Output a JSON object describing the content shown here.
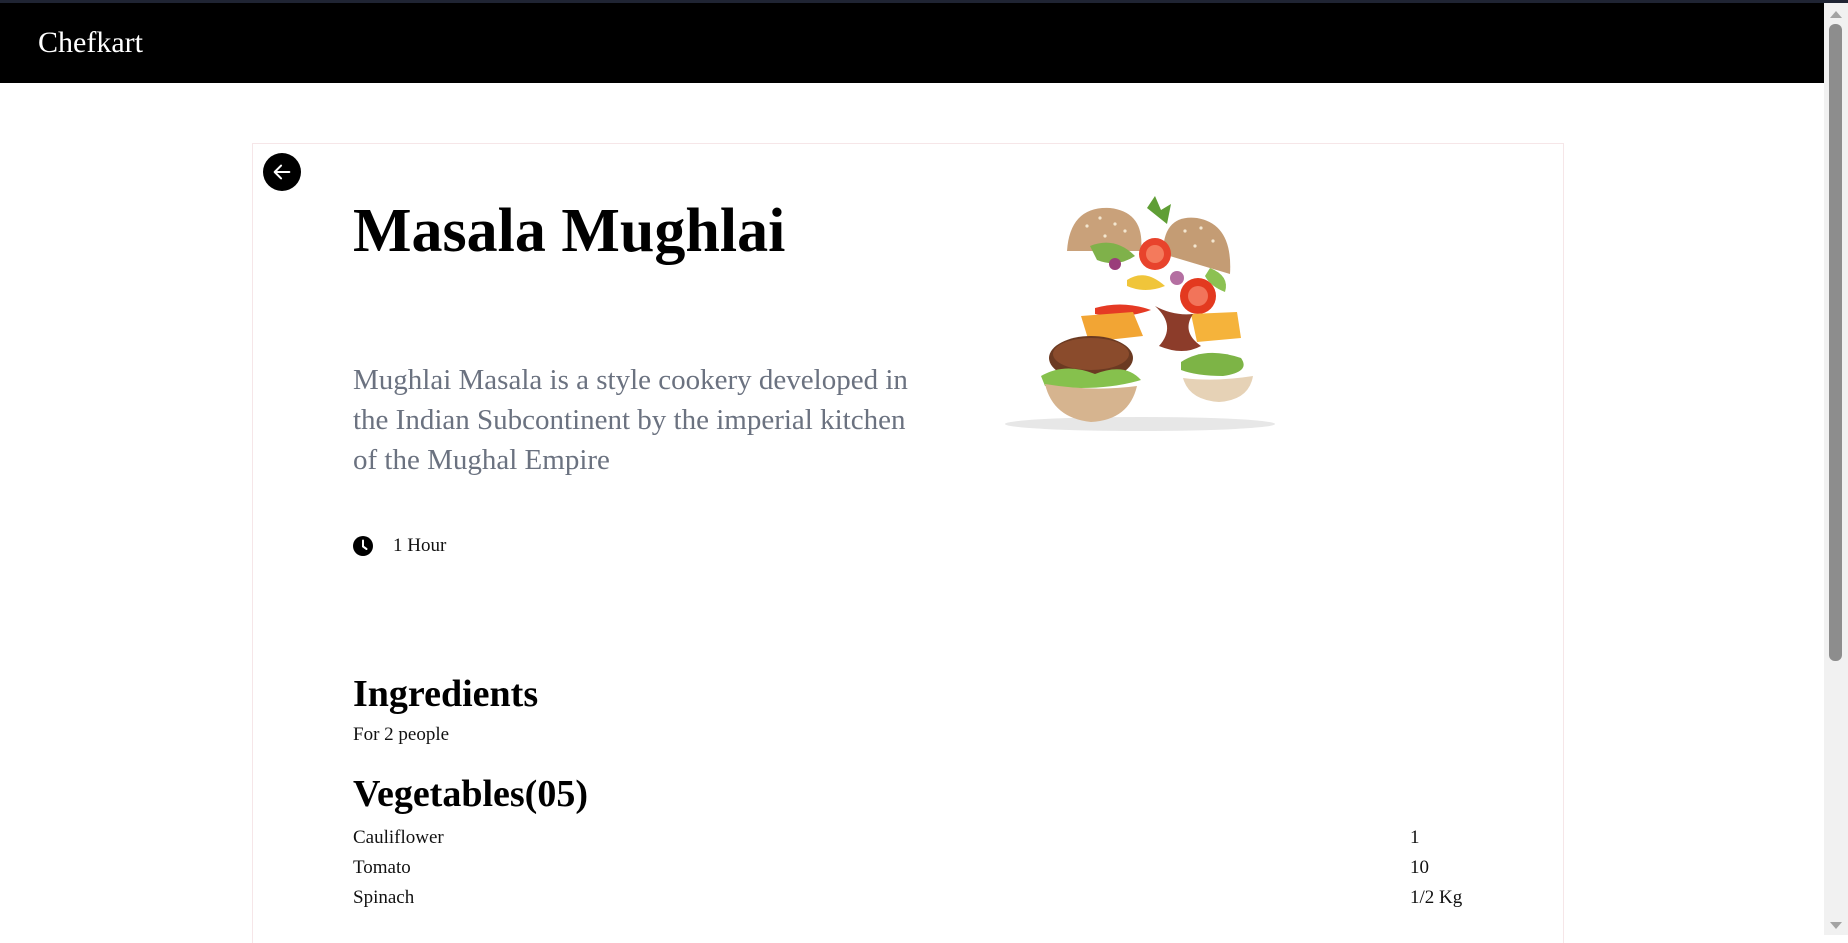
{
  "navbar": {
    "brand": "Chefkart"
  },
  "recipe": {
    "title": "Masala Mughlai",
    "description": "Mughlai Masala is a style cookery developed in the Indian Subcontinent by the imperial kitchen of the Mughal Empire",
    "time": "1 Hour"
  },
  "ingredients": {
    "heading": "Ingredients",
    "serves": "For 2 people",
    "vegetables": {
      "heading": "Vegetables(05)",
      "items": [
        {
          "name": "Cauliflower",
          "qty": "1"
        },
        {
          "name": "Tomato",
          "qty": "10"
        },
        {
          "name": "Spinach",
          "qty": "1/2 Kg"
        }
      ]
    }
  },
  "icons": {
    "back": "arrow-left-icon",
    "time": "clock-icon"
  },
  "colors": {
    "navbar_bg": "#000000",
    "description_text": "#6b7280",
    "card_border": "#f6e6e8"
  }
}
